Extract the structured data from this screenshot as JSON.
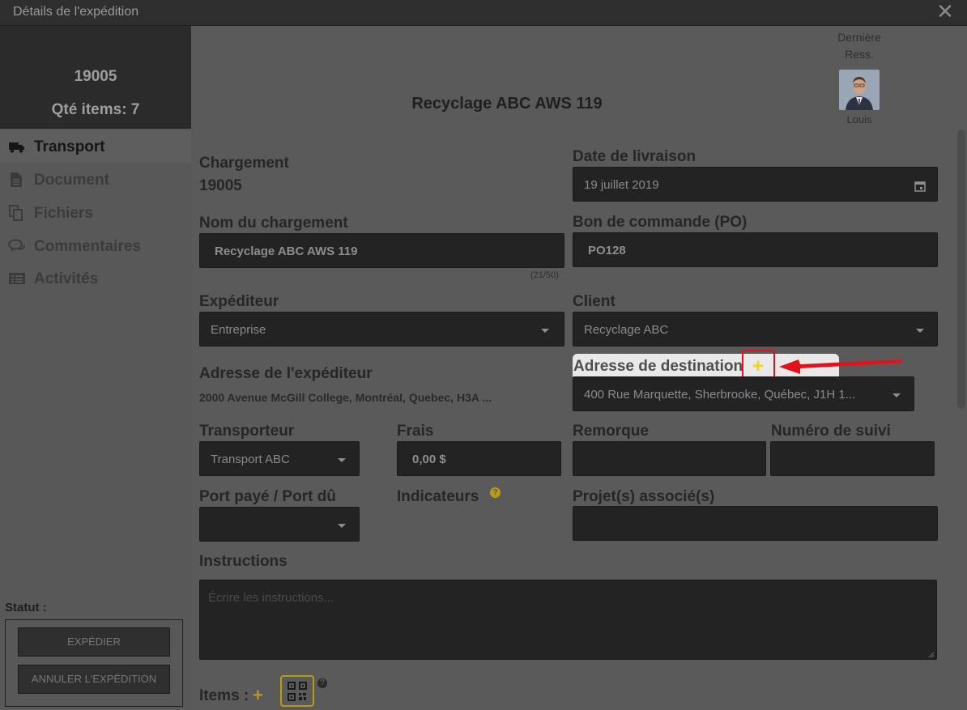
{
  "window": {
    "title": "Détails de l'expédition",
    "close_icon": "close-icon"
  },
  "summary": {
    "number": "19005",
    "qty": "Qté items: 7"
  },
  "header": {
    "shipment_name": "Recyclage ABC AWS 119",
    "last_res_line1": "Dernière",
    "last_res_line2": "Ress.",
    "user_name": "Louis"
  },
  "sidebar": {
    "items": [
      {
        "label": "Transport",
        "icon": "truck-icon",
        "active": true
      },
      {
        "label": "Document",
        "icon": "document-icon"
      },
      {
        "label": "Fichiers",
        "icon": "files-icon"
      },
      {
        "label": "Commentaires",
        "icon": "comments-icon"
      },
      {
        "label": "Activités",
        "icon": "activities-icon"
      }
    ],
    "status_label": "Statut :",
    "ship_button": "EXPÉDIER",
    "cancel_button": "ANNULER L'EXPÉDITION"
  },
  "form": {
    "chargement_label": "Chargement",
    "chargement_value": "19005",
    "date_label": "Date de livraison",
    "date_value": "19 juillet 2019",
    "nom_label": "Nom du chargement",
    "nom_value": "Recyclage ABC AWS 119",
    "nom_counter": "(21/50)",
    "po_label": "Bon de commande (PO)",
    "po_value": "PO128",
    "expediteur_label": "Expéditeur",
    "expediteur_value": "Entreprise",
    "client_label": "Client",
    "client_value": "Recyclage ABC",
    "adresse_exp_label": "Adresse de l'expéditeur",
    "adresse_exp_value": "2000 Avenue McGill College, Montréal, Quebec, H3A ...",
    "adresse_dest_label": "Adresse de destination",
    "adresse_dest_value": "400 Rue Marquette, Sherbrooke, Québec, J1H 1...",
    "transporteur_label": "Transporteur",
    "transporteur_value": "Transport ABC",
    "frais_label": "Frais",
    "frais_value": "0,00 $",
    "remorque_label": "Remorque",
    "remorque_value": "",
    "suivi_label": "Numéro de suivi",
    "suivi_value": "",
    "port_label": "Port payé / Port dû",
    "port_value": "",
    "indicateurs_label": "Indicateurs",
    "projets_label": "Projet(s) associé(s)",
    "projets_value": "",
    "instructions_label": "Instructions",
    "instructions_placeholder": "Écrire les instructions...",
    "items_label": "Items :"
  },
  "glyphs": {
    "plus": "+",
    "help": "?"
  },
  "colors": {
    "accent_yellow": "#f2d51a",
    "annotation_red": "#e5111a"
  }
}
